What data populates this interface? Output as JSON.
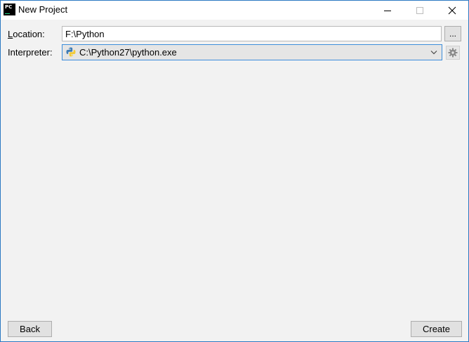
{
  "window": {
    "title": "New Project",
    "app_icon_text": "PC"
  },
  "form": {
    "location": {
      "label_accel": "L",
      "label_rest": "ocation:",
      "value": "F:\\Python",
      "browse_label": "..."
    },
    "interpreter": {
      "label": "Interpreter:",
      "selected": "C:\\Python27\\python.exe"
    }
  },
  "footer": {
    "back_label": "Back",
    "create_label": "Create"
  },
  "icons": {
    "app": "pycharm-icon",
    "minimize": "minimize-icon",
    "maximize": "maximize-icon",
    "close": "close-icon",
    "python": "python-icon",
    "chevron": "chevron-down-icon",
    "gear": "gear-icon"
  },
  "colors": {
    "window_border": "#2b79c2",
    "focus_border": "#3c8ddb",
    "dialog_background": "#f2f2f2",
    "button_face": "#e1e1e1"
  }
}
